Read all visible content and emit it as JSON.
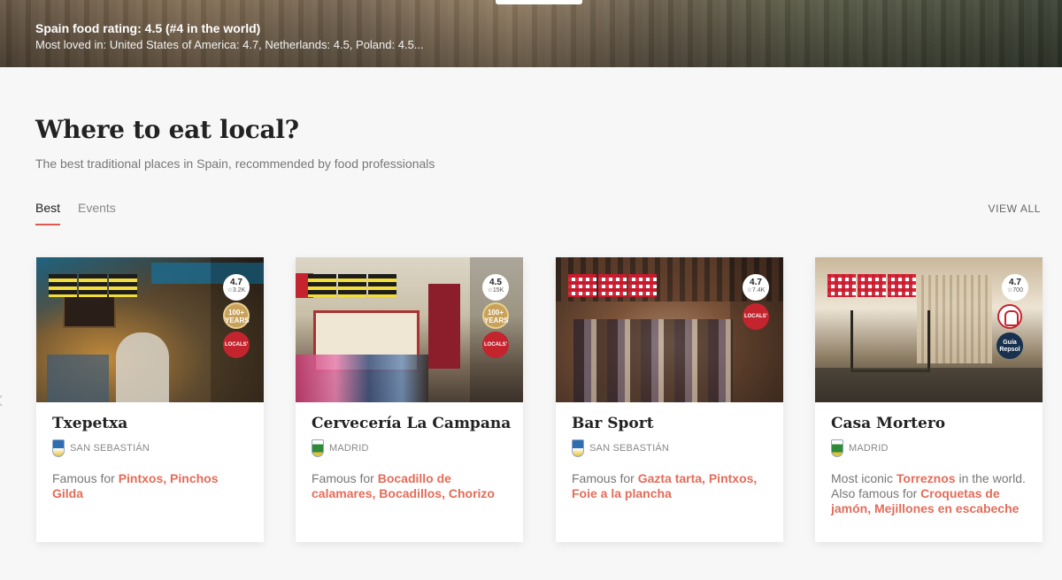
{
  "hero": {
    "rating": "Spain food rating: 4.5 (#4 in the world)",
    "loved": "Most loved in: United States of America: 4.7, Netherlands: 4.5, Poland: 4.5..."
  },
  "section": {
    "title": "Where to eat local?",
    "subtitle": "The best traditional places in Spain, recommended by food professionals"
  },
  "tabs": [
    {
      "label": "Best"
    },
    {
      "label": "Events"
    }
  ],
  "view_all": "VIEW ALL",
  "accent_color": "#e36c59",
  "cards": [
    {
      "name": "Txepetxa",
      "city": "SAN SEBASTIÁN",
      "rating": "4.7",
      "reviews": "☆3.2K",
      "years": "100+ YEARS",
      "locals": "LOCALS'",
      "famous_prefix": "Famous for ",
      "famous_items": "Pintxos, Pinchos Gilda",
      "photo_colors": [
        "#3a2c1f",
        "#c08a3c",
        "#5e4a2f",
        "#1d6a8c"
      ]
    },
    {
      "name": "Cervecería La Campana",
      "city": "MADRID",
      "rating": "4.5",
      "reviews": "☆15K",
      "years": "100+ YEARS",
      "locals": "LOCALS'",
      "famous_prefix": "Famous for ",
      "famous_items": "Bocadillo de calamares, Bocadillos, Chorizo",
      "photo_colors": [
        "#d8d1c2",
        "#8b1e2a",
        "#c9b996",
        "#6b5b4a"
      ]
    },
    {
      "name": "Bar Sport",
      "city": "SAN SEBASTIÁN",
      "rating": "4.7",
      "reviews": "☆7.4K",
      "locals": "LOCALS'",
      "famous_prefix": "Famous for ",
      "famous_items": "Gazta tarta, Pintxos, Foie a la plancha",
      "photo_colors": [
        "#5a3a28",
        "#a9856a",
        "#3c2a20",
        "#7a5238"
      ]
    },
    {
      "name": "Casa Mortero",
      "city": "MADRID",
      "rating": "4.7",
      "reviews": "☆700",
      "repsol": "Guía Repsol",
      "famous_prefix": "Most iconic ",
      "famous_iconic": "Torreznos",
      "famous_mid": " in the world. Also famous for ",
      "famous_items": "Croquetas de jamón, Mejillones en escabeche",
      "photo_colors": [
        "#c8b79a",
        "#5c4b38",
        "#ede4d4",
        "#2e2a24"
      ]
    }
  ]
}
